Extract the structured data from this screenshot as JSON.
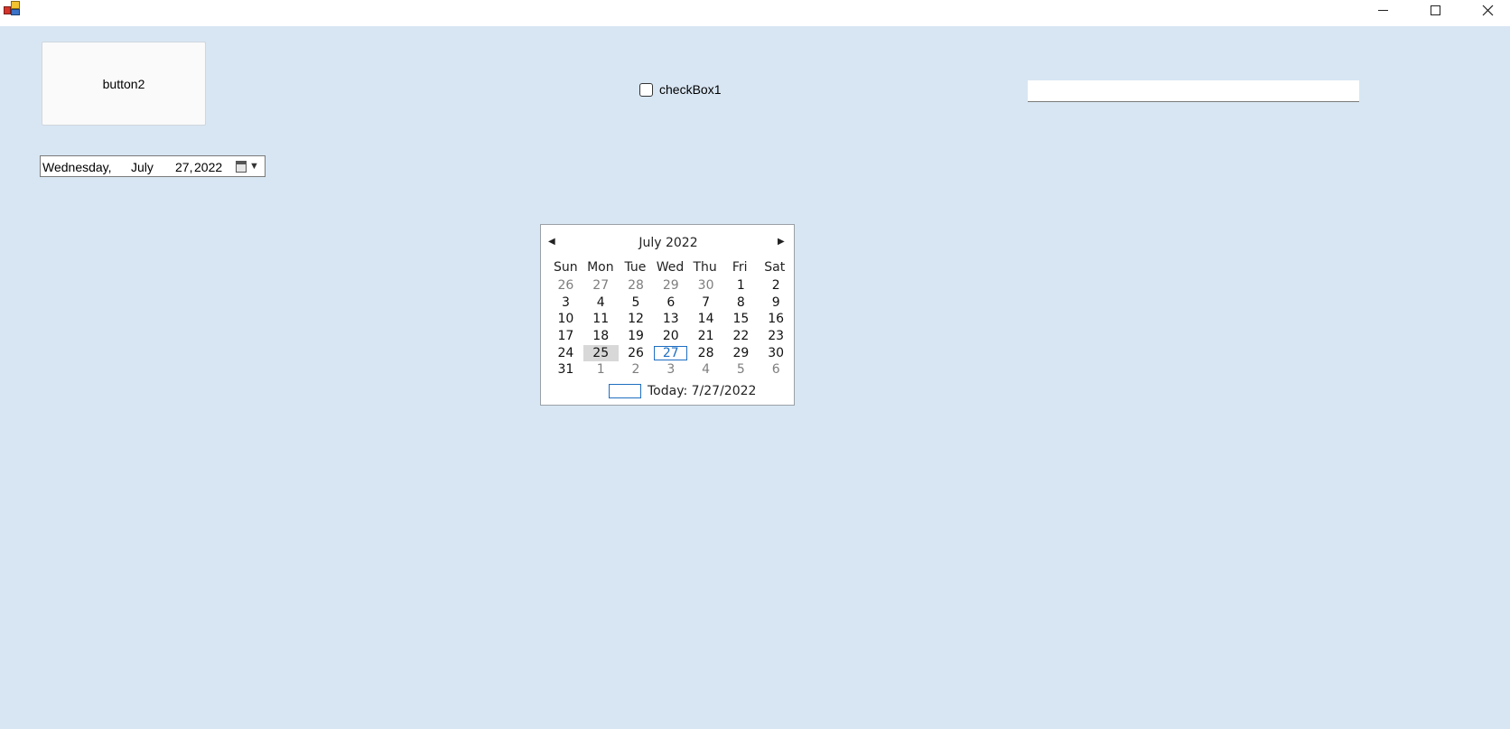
{
  "window": {
    "app_icon": "app-icon",
    "controls": [
      "minimize-icon",
      "maximize-icon",
      "close-icon"
    ]
  },
  "button2": {
    "label": "button2"
  },
  "checkBox1": {
    "label": "checkBox1",
    "checked": false
  },
  "textBox1": {
    "value": "",
    "placeholder": ""
  },
  "dateTimePicker": {
    "day_of_week": "Wednesday,",
    "month": "July",
    "day": "27,",
    "year": "2022",
    "icon": "calendar-icon"
  },
  "monthCalendar": {
    "title": "July 2022",
    "prev_icon": "left-arrow-icon",
    "next_icon": "right-arrow-icon",
    "weekdays": [
      "Sun",
      "Mon",
      "Tue",
      "Wed",
      "Thu",
      "Fri",
      "Sat"
    ],
    "days": [
      [
        "26",
        "27",
        "28",
        "29",
        "30",
        "1",
        "2"
      ],
      [
        "3",
        "4",
        "5",
        "6",
        "7",
        "8",
        "9"
      ],
      [
        "10",
        "11",
        "12",
        "13",
        "14",
        "15",
        "16"
      ],
      [
        "17",
        "18",
        "19",
        "20",
        "21",
        "22",
        "23"
      ],
      [
        "24",
        "25",
        "26",
        "27",
        "28",
        "29",
        "30"
      ],
      [
        "31",
        "1",
        "2",
        "3",
        "4",
        "5",
        "6"
      ]
    ],
    "selected_day": "25",
    "today_day": "27",
    "today_label": "Today: 7/27/2022"
  },
  "colors": {
    "background": "#d8e6f3",
    "accent": "#1f6fc1",
    "selected": "#d8d8d8"
  }
}
